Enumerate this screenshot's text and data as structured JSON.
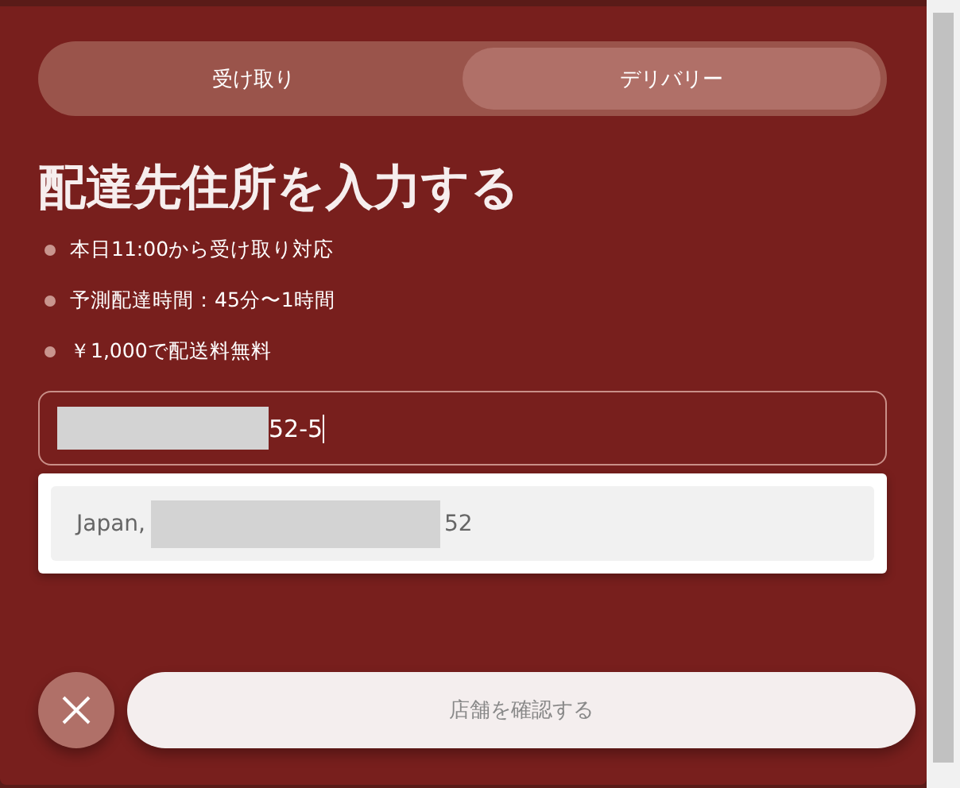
{
  "tabs": [
    {
      "label": "受け取り",
      "selected": false
    },
    {
      "label": "デリバリー",
      "selected": true
    }
  ],
  "title": "配達先住所を入力する",
  "notes": [
    "本日11:00から受け取り対応",
    "予測配達時間：45分〜1時間",
    "￥1,000で配送料無料"
  ],
  "address_field": {
    "value": "52-5"
  },
  "suggestions": [
    {
      "prefix": "Japan,",
      "suffix": "52"
    }
  ],
  "confirm_button": {
    "label": "店舗を確認する",
    "disabled": true
  }
}
